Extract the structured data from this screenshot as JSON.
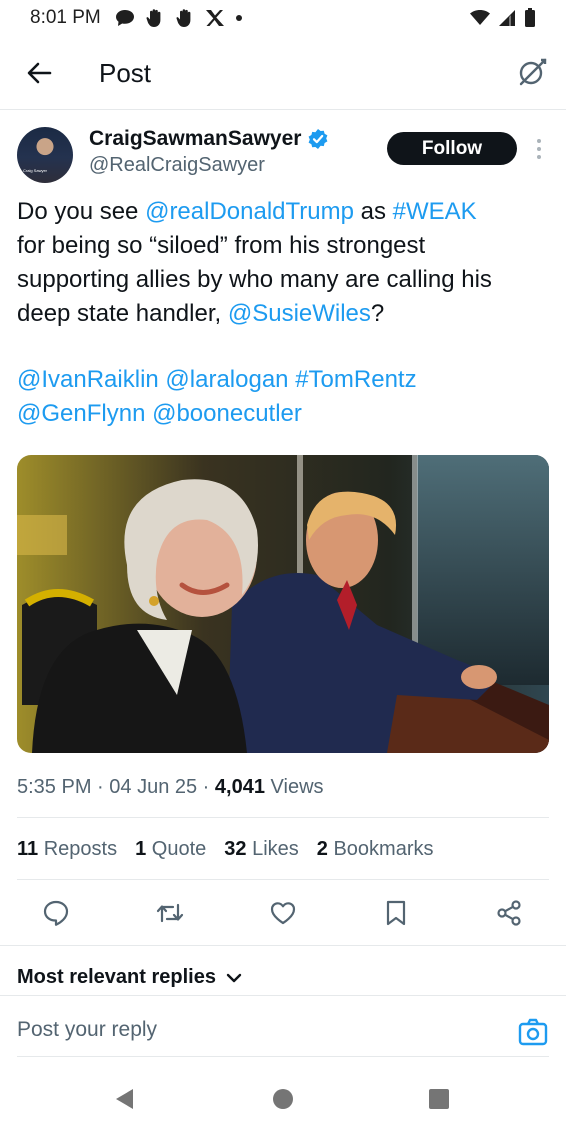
{
  "status_bar": {
    "time": "8:01 PM",
    "icons_left": [
      "chat-bubble-icon",
      "hand-icon",
      "hand-icon",
      "x-logo-icon",
      "dot-icon"
    ],
    "icons_right": [
      "wifi-icon",
      "signal-icon",
      "battery-icon"
    ]
  },
  "header": {
    "title": "Post"
  },
  "author": {
    "name": "CraigSawmanSawyer",
    "handle": "@RealCraigSawyer",
    "follow_label": "Follow",
    "avatar_caption": "Craig Sawyer"
  },
  "tweet": {
    "lines": [
      [
        {
          "t": "Do you see "
        },
        {
          "t": "@realDonaldTrump",
          "link": true
        },
        {
          "t": " as "
        },
        {
          "t": "#WEAK",
          "link": true
        }
      ],
      [
        {
          "t": "for being so “siloed” from his strongest"
        }
      ],
      [
        {
          "t": "supporting allies by who many are calling his"
        }
      ],
      [
        {
          "t": "deep state handler, "
        },
        {
          "t": "@SusieWiles",
          "link": true
        },
        {
          "t": "?"
        }
      ]
    ],
    "tag_lines": [
      [
        {
          "t": "@IvanRaiklin",
          "link": true
        },
        {
          "t": " "
        },
        {
          "t": "@laralogan",
          "link": true
        },
        {
          "t": "  "
        },
        {
          "t": "#TomRentz",
          "link": true
        }
      ],
      [
        {
          "t": "@GenFlynn",
          "link": true
        },
        {
          "t": " "
        },
        {
          "t": "@boonecutler",
          "link": true
        }
      ]
    ]
  },
  "meta": {
    "time": "5:35 PM",
    "sep1": " · ",
    "date": "04 Jun 25",
    "sep2": " · ",
    "views_count": "4,041",
    "views_label": " Views"
  },
  "stats": [
    {
      "count": "11",
      "label": " Reposts"
    },
    {
      "count": "1",
      "label": " Quote"
    },
    {
      "count": "32",
      "label": " Likes"
    },
    {
      "count": "2",
      "label": " Bookmarks"
    }
  ],
  "actions": [
    "reply-icon",
    "repost-icon",
    "like-icon",
    "bookmark-icon",
    "share-icon"
  ],
  "replies": {
    "sort_label": "Most relevant replies",
    "placeholder": "Post your reply"
  },
  "colors": {
    "link": "#1d9bf0",
    "text": "#0f1419",
    "muted": "#536471",
    "divider": "#e6e9eb"
  }
}
